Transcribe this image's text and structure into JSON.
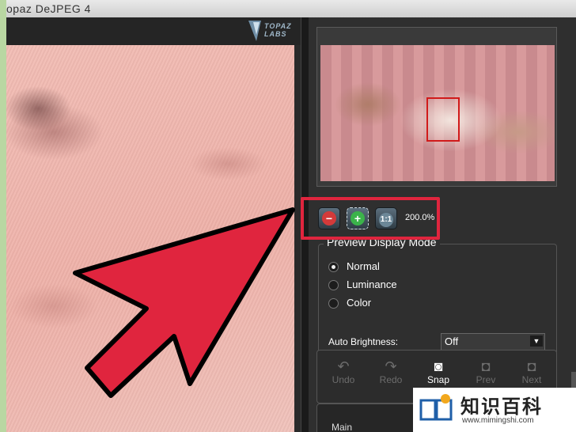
{
  "window": {
    "title": "opaz DeJPEG 4"
  },
  "logo": {
    "text": "TOPAZ LABS"
  },
  "zoom": {
    "minus_glyph": "−",
    "plus_glyph": "+",
    "one_to_one": "1:1",
    "level": "200.0%"
  },
  "preview_display_mode": {
    "title": "Preview Display Mode",
    "options": [
      {
        "label": "Normal",
        "selected": true
      },
      {
        "label": "Luminance",
        "selected": false
      },
      {
        "label": "Color",
        "selected": false
      }
    ],
    "auto_brightness_label": "Auto Brightness:",
    "auto_brightness_value": "Off"
  },
  "toolbar": {
    "buttons": [
      {
        "label": "Undo",
        "icon": "undo-icon",
        "enabled": false
      },
      {
        "label": "Redo",
        "icon": "redo-icon",
        "enabled": false
      },
      {
        "label": "Snap",
        "icon": "camera-icon",
        "enabled": true
      },
      {
        "label": "Prev",
        "icon": "prev-snapshot-icon",
        "enabled": false
      },
      {
        "label": "Next",
        "icon": "next-snapshot-icon",
        "enabled": false
      }
    ]
  },
  "bottom": {
    "main_label": "Main"
  },
  "watermark": {
    "title": "知识百科",
    "url": "www.mimingshi.com"
  },
  "colors": {
    "arrow": "#e0253e",
    "highlight": "#e0253e",
    "panel": "#2f2f2f"
  }
}
